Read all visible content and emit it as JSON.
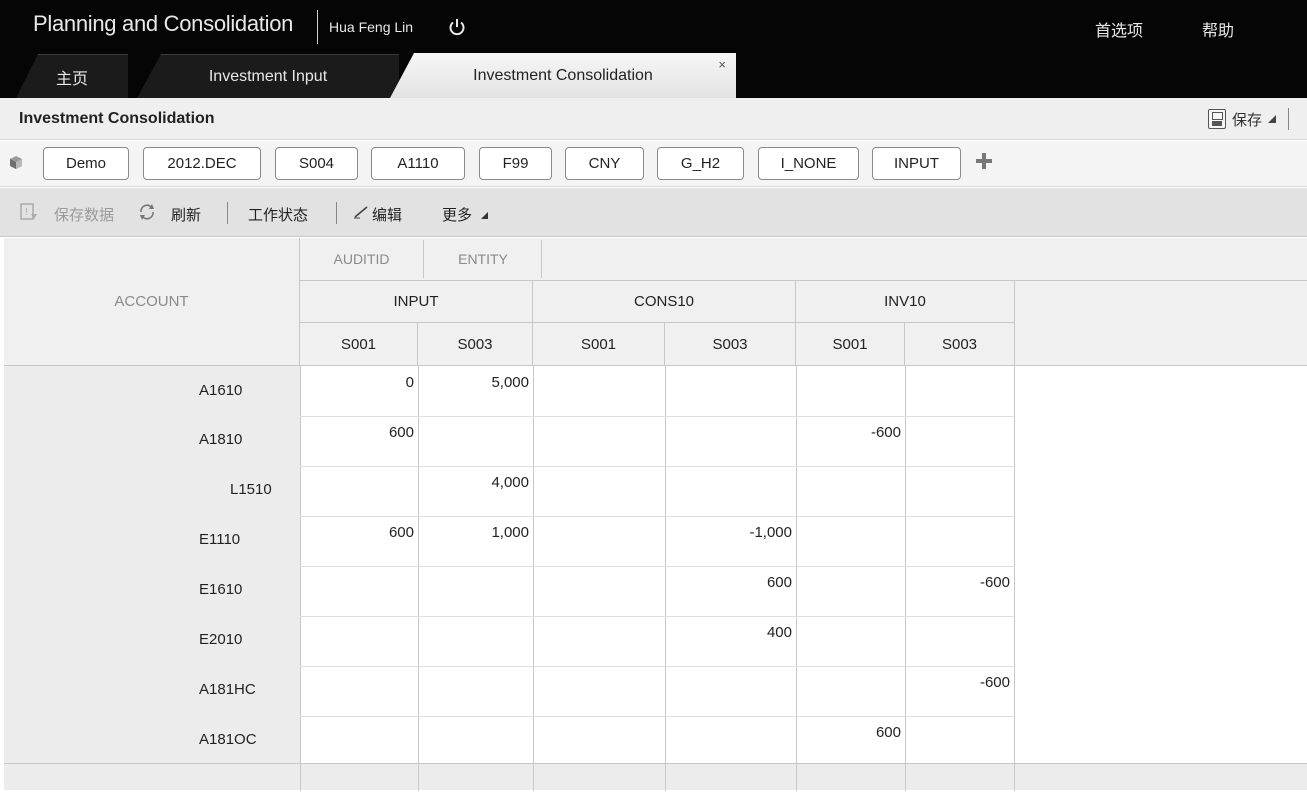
{
  "app": {
    "title": "Planning and Consolidation",
    "user": "Hua Feng Lin",
    "preferences": "首选项",
    "help": "帮助"
  },
  "tabs": [
    {
      "label": "主页"
    },
    {
      "label": "Investment Input"
    },
    {
      "label": "Investment Consolidation",
      "close": "×"
    }
  ],
  "page": {
    "title": "Investment Consolidation",
    "save_label": "保存"
  },
  "context": {
    "members": [
      "Demo",
      "2012.DEC",
      "S004",
      "A1110",
      "F99",
      "CNY",
      "G_H2",
      "I_NONE",
      "INPUT"
    ]
  },
  "toolbar": {
    "save_data": "保存数据",
    "refresh": "刷新",
    "work_status": "工作状态",
    "edit": "编辑",
    "more": "更多"
  },
  "grid": {
    "dim_audit": "AUDITID",
    "dim_entity": "ENTITY",
    "dim_account": "ACCOUNT",
    "groups": [
      "INPUT",
      "CONS10",
      "INV10"
    ],
    "columns": [
      "S001",
      "S003",
      "S001",
      "S003",
      "S001",
      "S003"
    ],
    "rows": [
      {
        "account": "A1610",
        "values": [
          "0",
          "5,000",
          "",
          "",
          "",
          ""
        ]
      },
      {
        "account": "A1810",
        "values": [
          "600",
          "",
          "",
          "",
          "-600",
          ""
        ]
      },
      {
        "account": "L1510",
        "values": [
          "",
          "4,000",
          "",
          "",
          "",
          ""
        ]
      },
      {
        "account": "E1110",
        "values": [
          "600",
          "1,000",
          "",
          "-1,000",
          "",
          ""
        ]
      },
      {
        "account": "E1610",
        "values": [
          "",
          "",
          "",
          "600",
          "",
          "-600"
        ]
      },
      {
        "account": "E2010",
        "values": [
          "",
          "",
          "",
          "400",
          "",
          ""
        ]
      },
      {
        "account": "A181HC",
        "values": [
          "",
          "",
          "",
          "",
          "",
          "-600"
        ]
      },
      {
        "account": "A181OC",
        "values": [
          "",
          "",
          "",
          "",
          "600",
          ""
        ]
      }
    ]
  }
}
